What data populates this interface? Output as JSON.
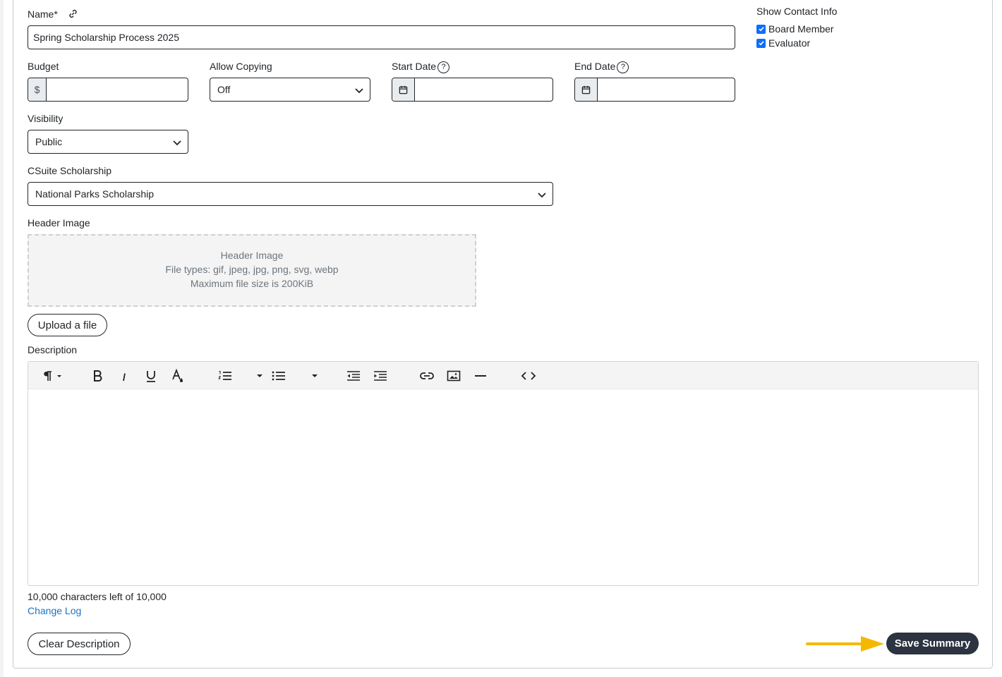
{
  "form": {
    "name_label": "Name*",
    "name_value": "Spring Scholarship Process 2025",
    "budget_label": "Budget",
    "budget_prefix": "$",
    "budget_value": "",
    "allow_copying_label": "Allow Copying",
    "allow_copying_value": "Off",
    "start_date_label": "Start Date",
    "end_date_label": "End Date",
    "help_glyph": "?",
    "visibility_label": "Visibility",
    "visibility_value": "Public",
    "csuite_label": "CSuite Scholarship",
    "csuite_value": "National Parks Scholarship",
    "header_image_label": "Header Image",
    "dropzone": {
      "title": "Header Image",
      "file_types": "File types: gif, jpeg, jpg, png, svg, webp",
      "max_size": "Maximum file size is 200KiB"
    },
    "upload_button": "Upload a file",
    "description_label": "Description",
    "char_count": "10,000 characters left of 10,000",
    "change_log": "Change Log",
    "clear_button": "Clear Description",
    "save_button": "Save Summary"
  },
  "contact_info": {
    "title": "Show Contact Info",
    "options": [
      {
        "label": "Board Member",
        "checked": true
      },
      {
        "label": "Evaluator",
        "checked": true
      }
    ]
  },
  "toolbar_icons": [
    "paragraph-icon",
    "bold-icon",
    "italic-icon",
    "underline-icon",
    "text-color-icon",
    "ordered-list-icon",
    "unordered-list-icon",
    "outdent-icon",
    "indent-icon",
    "link-icon",
    "image-icon",
    "horizontal-rule-icon",
    "code-view-icon"
  ],
  "colors": {
    "accent": "#0d6efd",
    "save_button_bg": "#2b3440",
    "arrow": "#f5b800",
    "link": "#1a73c8"
  }
}
